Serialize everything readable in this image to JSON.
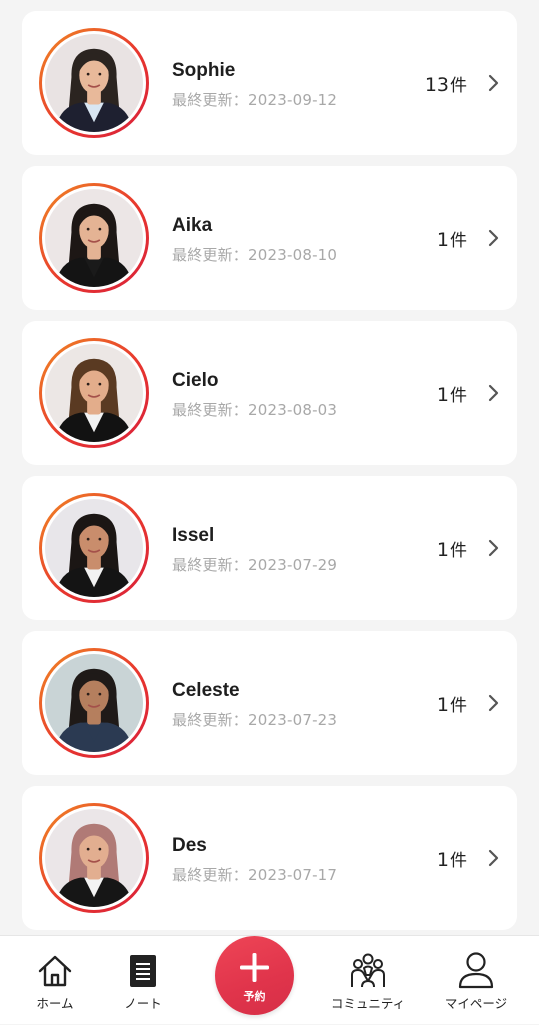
{
  "items": [
    {
      "name": "Sophie",
      "updated": "最終更新：2023-09-12",
      "count": "13",
      "unit": "件",
      "bg": "#e9e3e3",
      "hair": "#2b2420",
      "skin": "#e8b99a",
      "outfit": "#1e2030",
      "shirt": "#d9e6f2"
    },
    {
      "name": "Aika",
      "updated": "最終更新：2023-08-10",
      "count": "1",
      "unit": "件",
      "bg": "#ece6e6",
      "hair": "#1d1715",
      "skin": "#e4b394",
      "outfit": "#141414",
      "shirt": "#1a1a1a"
    },
    {
      "name": "Cielo",
      "updated": "最終更新：2023-08-03",
      "count": "1",
      "unit": "件",
      "bg": "#ece7e5",
      "hair": "#5a3a22",
      "skin": "#e3ad8b",
      "outfit": "#121212",
      "shirt": "#f2f2f2"
    },
    {
      "name": "Issel",
      "updated": "最終更新：2023-07-29",
      "count": "1",
      "unit": "件",
      "bg": "#e8e6ea",
      "hair": "#1b1614",
      "skin": "#c98d6c",
      "outfit": "#141414",
      "shirt": "#f2f2f2"
    },
    {
      "name": "Celeste",
      "updated": "最終更新：2023-07-23",
      "count": "1",
      "unit": "件",
      "bg": "#c9d4d6",
      "hair": "#1f1a18",
      "skin": "#b57f5e",
      "outfit": "#2b3a52",
      "shirt": "#2b3a52"
    },
    {
      "name": "Des",
      "updated": "最終更新：2023-07-17",
      "count": "1",
      "unit": "件",
      "bg": "#ebe6e8",
      "hair": "#b07a76",
      "skin": "#e2ae90",
      "outfit": "#161616",
      "shirt": "#f4f4f4"
    }
  ],
  "nav": {
    "home_label": "ホーム",
    "note_label": "ノート",
    "reserve_label": "予約",
    "community_label": "コミュニティ",
    "mypage_label": "マイページ"
  },
  "colors": {
    "ring_start": "#f08a24",
    "ring_end": "#d81f3b",
    "fab": "#e0344b",
    "muted_text": "#a8a8a8"
  },
  "icons": {
    "home": "home-icon",
    "note": "note-icon",
    "reserve": "plus-icon",
    "community": "community-icon",
    "mypage": "person-icon",
    "row_arrow": "chevron-right-icon"
  }
}
